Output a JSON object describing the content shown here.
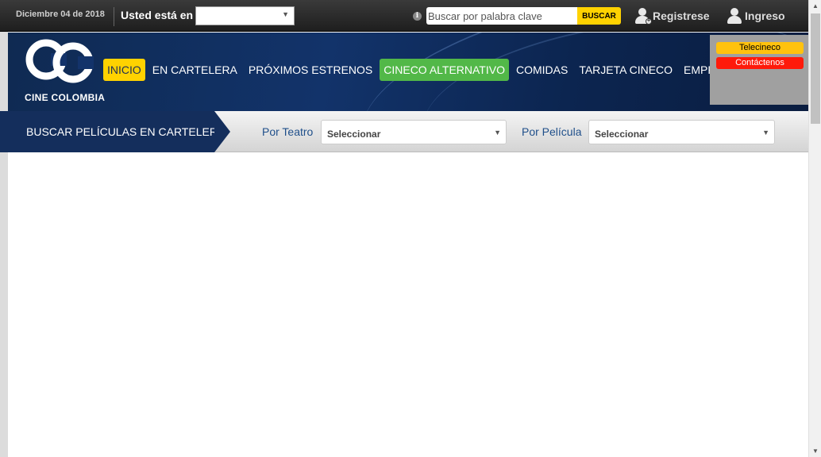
{
  "topbar": {
    "date": "Diciembre 04 de 2018",
    "location_label": "Usted está en",
    "location_value": "",
    "search_placeholder": "Buscar por palabra clave",
    "search_button": "BUSCAR",
    "register": "Registrese",
    "login": "Ingreso"
  },
  "header": {
    "logo_text": "CINE COLOMBIA",
    "nav": [
      "INICIO",
      "EN CARTELERA",
      "PRÓXIMOS ESTRENOS",
      "CINECO ALTERNATIVO",
      "COMIDAS",
      "TARJETA CINECO",
      "EMPRESARIAL"
    ],
    "side_buttons": {
      "telecineco": "Telecineco",
      "contact": "Contáctenos"
    }
  },
  "searchbar": {
    "title": "BUSCAR PELÍCULAS EN CARTELERA",
    "theater_label": "Por Teatro",
    "theater_value": "Seleccionar",
    "movie_label": "Por Película",
    "movie_value": "Seleccionar"
  },
  "colors": {
    "accent_yellow": "#ffd200",
    "alt_green": "#52b848",
    "brand_blue": "#142e5c",
    "contact_red": "#ff1a0a"
  },
  "icons": {
    "info": "info-icon",
    "register": "user-plus-icon",
    "login": "user-icon"
  }
}
